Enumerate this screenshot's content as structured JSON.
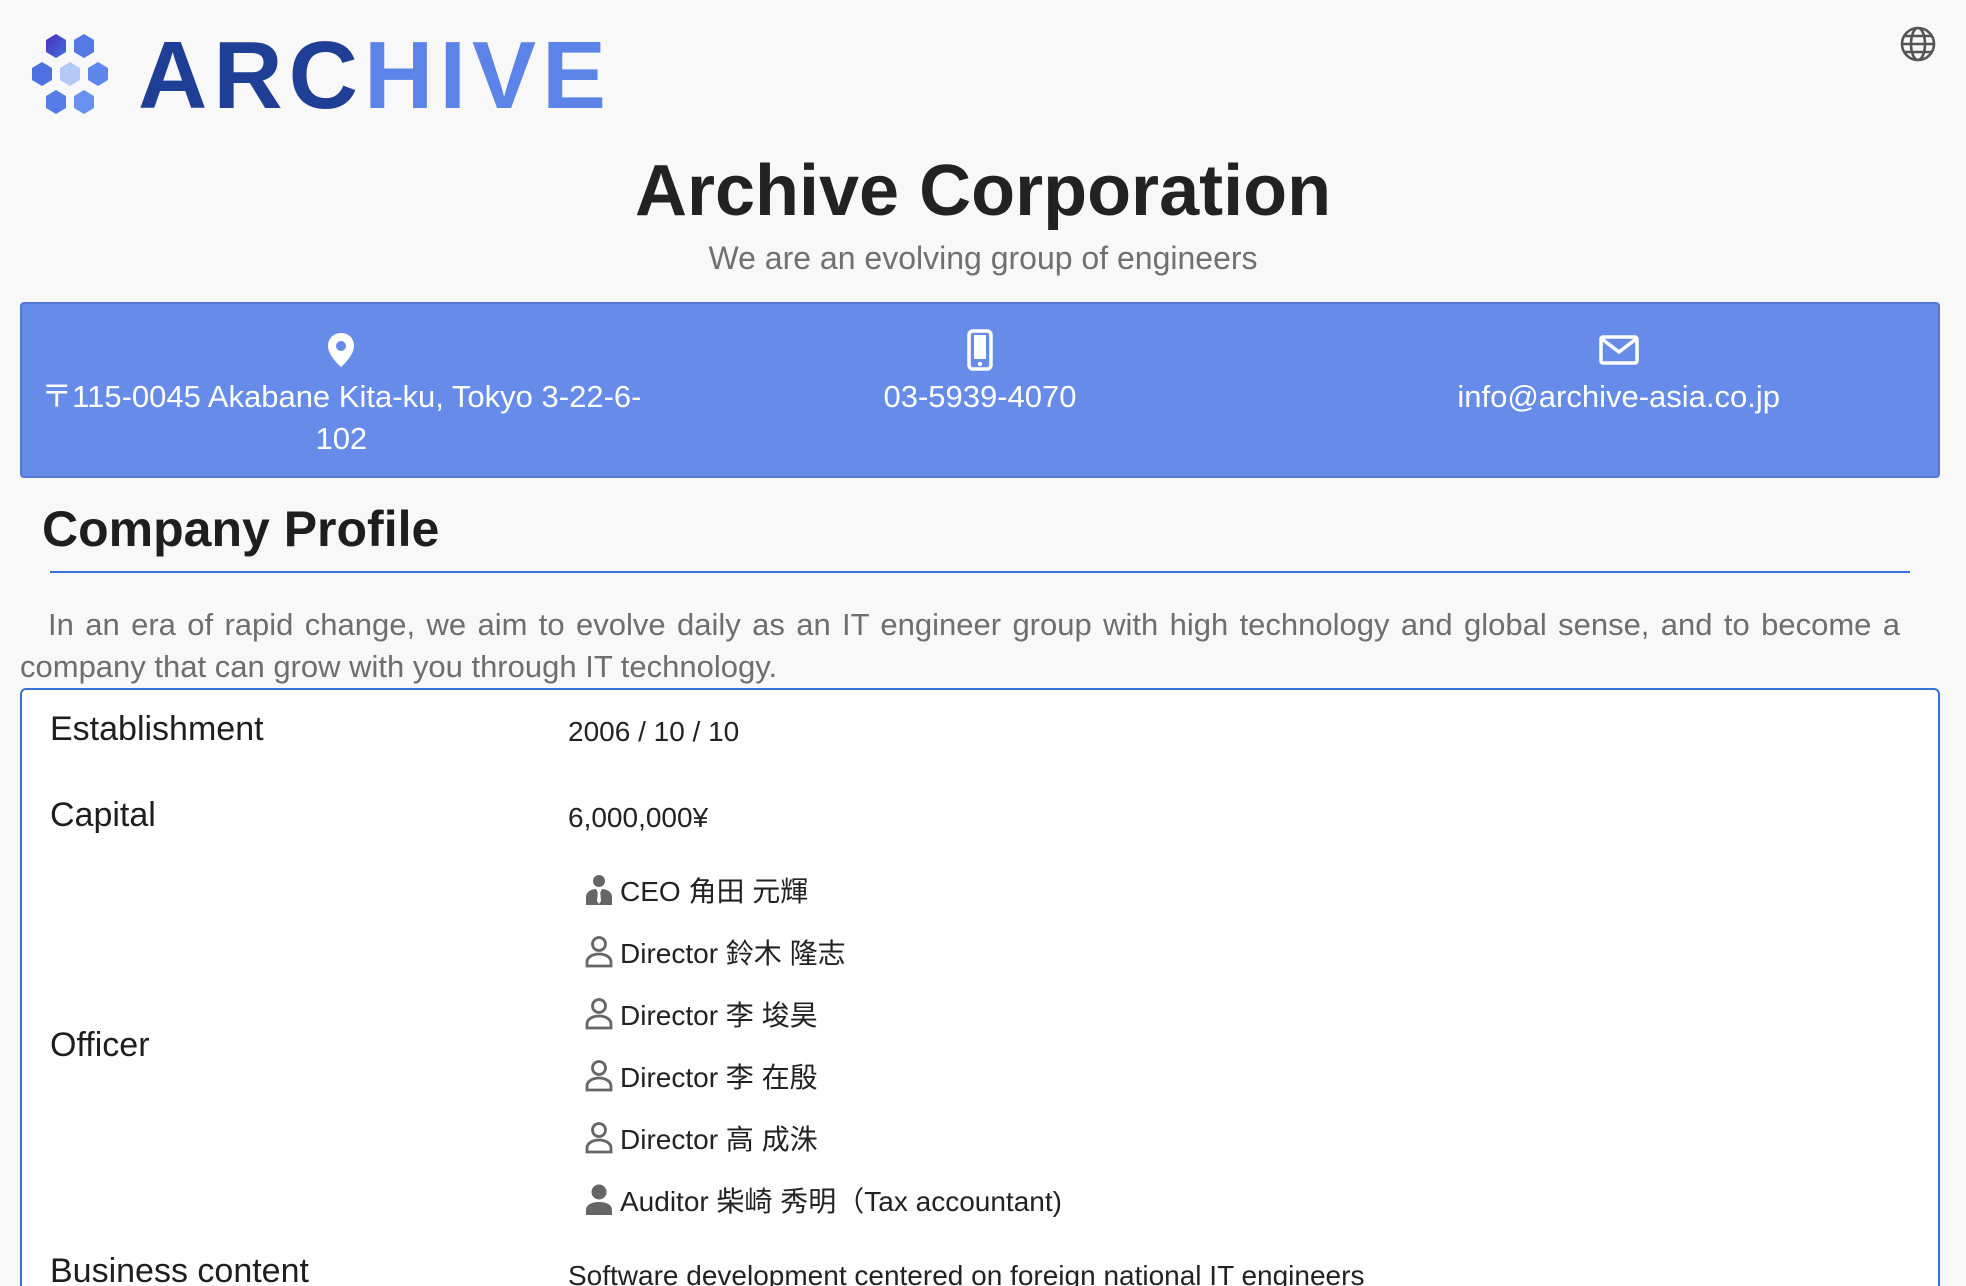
{
  "header": {
    "logo_part1": "ARC",
    "logo_part2": "HIVE",
    "globe_icon": "globe-icon",
    "title": "Archive Corporation",
    "subtitle": "We are an evolving group of engineers"
  },
  "contact": {
    "address": "〒115-0045 Akabane Kita-ku, Tokyo 3-22-6-102",
    "phone": "03-5939-4070",
    "email": "info@archive-asia.co.jp",
    "icons": [
      "location-pin-icon",
      "smartphone-icon",
      "mail-icon"
    ]
  },
  "profile": {
    "heading": "Company Profile",
    "intro": "In an era of rapid change, we aim to evolve daily as an IT engineer group with high technology and global sense, and to become a company that can grow with you through IT technology.",
    "establishment_label": "Establishment",
    "establishment_value": "2006 / 10 / 10",
    "capital_label": "Capital",
    "capital_value": "6,000,000¥",
    "officer_label": "Officer",
    "officers": [
      {
        "text": "CEO 角田 元輝",
        "icon": "ceo-icon"
      },
      {
        "text": "Director 鈴木 隆志",
        "icon": "person-outline-icon"
      },
      {
        "text": "Director 李 埈昊",
        "icon": "person-outline-icon"
      },
      {
        "text": "Director 李 在殷",
        "icon": "person-outline-icon"
      },
      {
        "text": "Director 高 成洙",
        "icon": "person-outline-icon"
      },
      {
        "text": "Auditor 柴崎 秀明（Tax accountant)",
        "icon": "person-filled-icon"
      }
    ],
    "business_label": "Business content",
    "business_value": "Software development centered on foreign national IT engineers"
  },
  "colors": {
    "logo_dark": "#1f3e96",
    "logo_light": "#5c84e8",
    "contact_band": "#668be9",
    "accent": "#3c72d8"
  }
}
